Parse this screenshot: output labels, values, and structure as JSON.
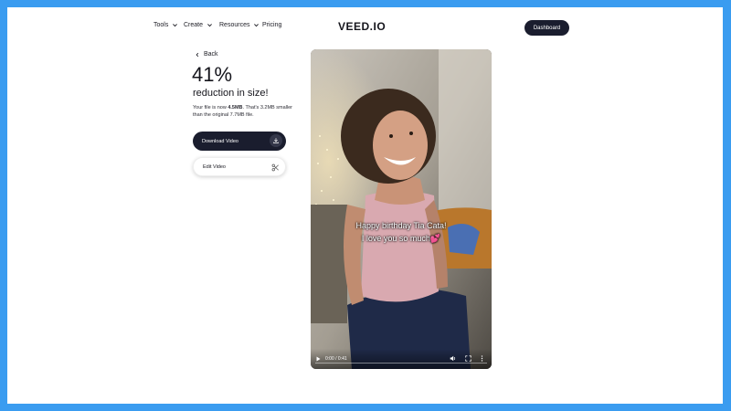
{
  "header": {
    "nav": [
      {
        "label": "Tools",
        "has_dropdown": true
      },
      {
        "label": "Create",
        "has_dropdown": true
      },
      {
        "label": "Resources",
        "has_dropdown": true
      },
      {
        "label": "Pricing",
        "has_dropdown": false
      }
    ],
    "logo": "VEED.IO",
    "dashboard_label": "Dashboard"
  },
  "result": {
    "back_label": "Back",
    "percent": "41%",
    "subtitle": "reduction in size!",
    "desc_prefix": "Your file is now ",
    "new_size": "4.5MB",
    "desc_suffix": ". That's 3.2MB smaller than the original 7.7MB file."
  },
  "actions": {
    "download_label": "Download Video",
    "edit_label": "Edit Video"
  },
  "video": {
    "caption_line1": "Happy birthday Tia Cata!",
    "caption_line2": "I love you so much",
    "caption_emoji": "💕",
    "time": "0:00 / 0:41",
    "progress": 0
  },
  "colors": {
    "frame": "#3a9cf0",
    "dark_button": "#1a1d2e",
    "sofa": "#b9772c",
    "top": "#d9a9b0",
    "pants": "#1f2a48"
  },
  "icons": [
    "chevron-down-icon",
    "chevron-left-icon",
    "download-icon",
    "scissors-icon",
    "play-icon",
    "volume-icon",
    "fullscreen-icon",
    "more-vertical-icon"
  ]
}
